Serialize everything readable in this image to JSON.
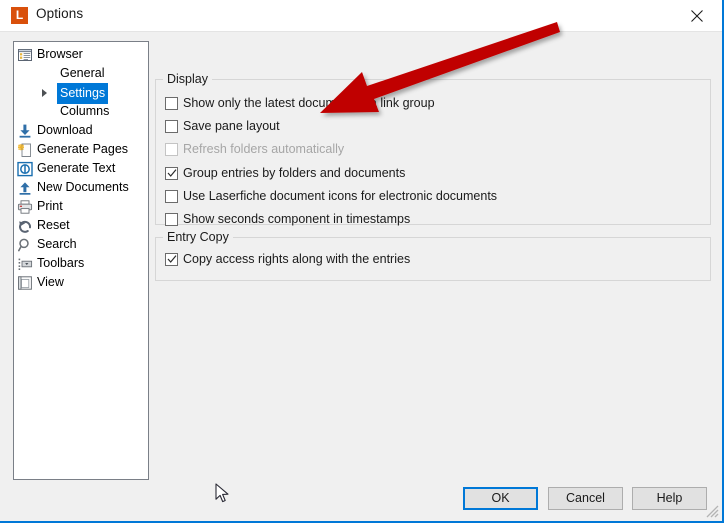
{
  "window": {
    "title": "Options",
    "logo_letter": "L",
    "logo_color": "#d9500b",
    "accent_color": "#0078d7",
    "background_color": "#f0f0f0",
    "close_icon": "close-icon"
  },
  "sidebar": {
    "items": [
      {
        "label": "Browser",
        "icon": "browser-icon",
        "level": 0,
        "selected": false,
        "expander": false
      },
      {
        "label": "General",
        "icon": "none",
        "level": 1,
        "selected": false,
        "expander": false
      },
      {
        "label": "Settings",
        "icon": "none",
        "level": 1,
        "selected": true,
        "expander": true
      },
      {
        "label": "Columns",
        "icon": "none",
        "level": 1,
        "selected": false,
        "expander": false
      },
      {
        "label": "Download",
        "icon": "download-arrow-icon",
        "level": 0,
        "selected": false,
        "expander": false
      },
      {
        "label": "Generate Pages",
        "icon": "generate-pages-icon",
        "level": 0,
        "selected": false,
        "expander": false
      },
      {
        "label": "Generate Text",
        "icon": "generate-text-icon",
        "level": 0,
        "selected": false,
        "expander": false
      },
      {
        "label": "New Documents",
        "icon": "upload-arrow-icon",
        "level": 0,
        "selected": false,
        "expander": false
      },
      {
        "label": "Print",
        "icon": "printer-icon",
        "level": 0,
        "selected": false,
        "expander": false
      },
      {
        "label": "Reset",
        "icon": "reset-undo-icon",
        "level": 0,
        "selected": false,
        "expander": false
      },
      {
        "label": "Search",
        "icon": "magnifier-icon",
        "level": 0,
        "selected": false,
        "expander": false
      },
      {
        "label": "Toolbars",
        "icon": "toolbars-icon",
        "level": 0,
        "selected": false,
        "expander": false
      },
      {
        "label": "View",
        "icon": "view-page-icon",
        "level": 0,
        "selected": false,
        "expander": false
      }
    ]
  },
  "display_group": {
    "legend": "Display",
    "options": [
      {
        "label": "Show only the latest document in a link group",
        "checked": false,
        "enabled": true
      },
      {
        "label": "Save pane layout",
        "checked": false,
        "enabled": true
      },
      {
        "label": "Refresh folders automatically",
        "checked": false,
        "enabled": false
      },
      {
        "label": "Group entries by folders and documents",
        "checked": true,
        "enabled": true
      },
      {
        "label": "Use Laserfiche document icons for electronic documents",
        "checked": false,
        "enabled": true
      },
      {
        "label": "Show seconds component in timestamps",
        "checked": false,
        "enabled": true
      }
    ]
  },
  "entry_copy_group": {
    "legend": "Entry Copy",
    "options": [
      {
        "label": "Copy access rights along with the entries",
        "checked": true,
        "enabled": true
      }
    ]
  },
  "buttons": {
    "ok": "OK",
    "cancel": "Cancel",
    "help": "Help"
  },
  "annotation": {
    "type": "arrow",
    "color": "#c00000",
    "points_to": "Refresh folders automatically"
  }
}
